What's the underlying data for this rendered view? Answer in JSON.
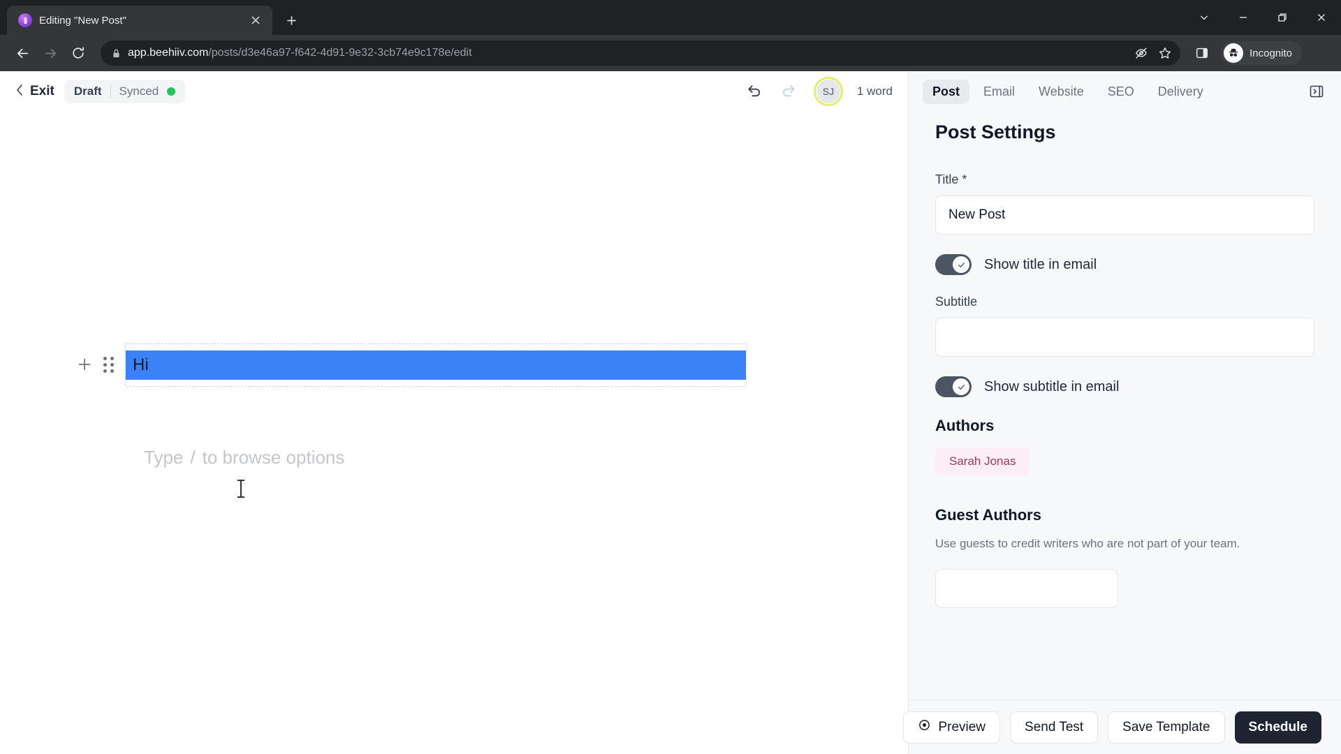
{
  "browser": {
    "tab": {
      "title": "Editing \"New Post\"",
      "favicon_icon": "beehiiv-bee-icon",
      "close_icon": "close-icon"
    },
    "new_tab_icon": "plus-icon",
    "window_controls": [
      {
        "name": "chevron-down-icon",
        "glyph": "chevron-down"
      },
      {
        "name": "minimize-icon",
        "glyph": "minimize"
      },
      {
        "name": "maximize-icon",
        "glyph": "maximize"
      },
      {
        "name": "close-window-icon",
        "glyph": "close"
      }
    ],
    "nav": {
      "back_icon": "back-arrow-icon",
      "forward_icon": "forward-arrow-icon",
      "reload_icon": "reload-icon"
    },
    "omnibox": {
      "lock_icon": "lock-icon",
      "url_domain": "app.beehiiv.com",
      "url_path": "/posts/d3e46a97-f642-4d91-9e32-3cb74e9c178e/edit",
      "tracking_icon": "eye-off-icon",
      "bookmark_icon": "star-icon"
    },
    "side_panel_icon": "side-panel-icon",
    "incognito_label": "Incognito",
    "incognito_icon": "incognito-hat-icon",
    "menu_icon": "three-dot-menu-icon"
  },
  "app_header": {
    "exit_label": "Exit",
    "back_icon": "chevron-left-icon",
    "status_draft": "Draft",
    "status_sync": "Synced",
    "sync_dot_color": "#22c55e",
    "undo_icon": "undo-icon",
    "redo_icon": "redo-icon",
    "avatar_initials": "SJ",
    "avatar_ring_color": "#e3ee68",
    "word_count": "1 word"
  },
  "editor": {
    "add_block_icon": "plus-icon",
    "drag_handle_icon": "drag-handle-icon",
    "block_text": "Hi",
    "selection_color": "#3b82f6",
    "placeholder_prefix": "Type",
    "placeholder_slash": "/",
    "placeholder_suffix": "to browse options"
  },
  "panel": {
    "tabs": [
      {
        "label": "Post",
        "active": true
      },
      {
        "label": "Email",
        "active": false
      },
      {
        "label": "Website",
        "active": false
      },
      {
        "label": "SEO",
        "active": false
      },
      {
        "label": "Delivery",
        "active": false
      }
    ],
    "collapse_icon": "collapse-panel-icon",
    "title": "Post Settings",
    "title_field": {
      "label": "Title *",
      "value": "New Post",
      "placeholder": ""
    },
    "show_title_toggle": {
      "label": "Show title in email",
      "checked": true,
      "check_icon": "check-icon"
    },
    "subtitle_field": {
      "label": "Subtitle",
      "value": "",
      "placeholder": ""
    },
    "show_subtitle_toggle": {
      "label": "Show subtitle in email",
      "checked": true,
      "check_icon": "check-icon"
    },
    "authors": {
      "heading": "Authors",
      "chips": [
        {
          "name": "Sarah Jonas"
        }
      ]
    },
    "guest_authors": {
      "heading": "Guest Authors",
      "description": "Use guests to credit writers who are not part of your team."
    },
    "footer": {
      "preview_label": "Preview",
      "preview_icon": "eye-icon",
      "send_test_label": "Send Test",
      "save_template_label": "Save Template",
      "schedule_label": "Schedule",
      "schedule_color": "#1e2532"
    }
  }
}
